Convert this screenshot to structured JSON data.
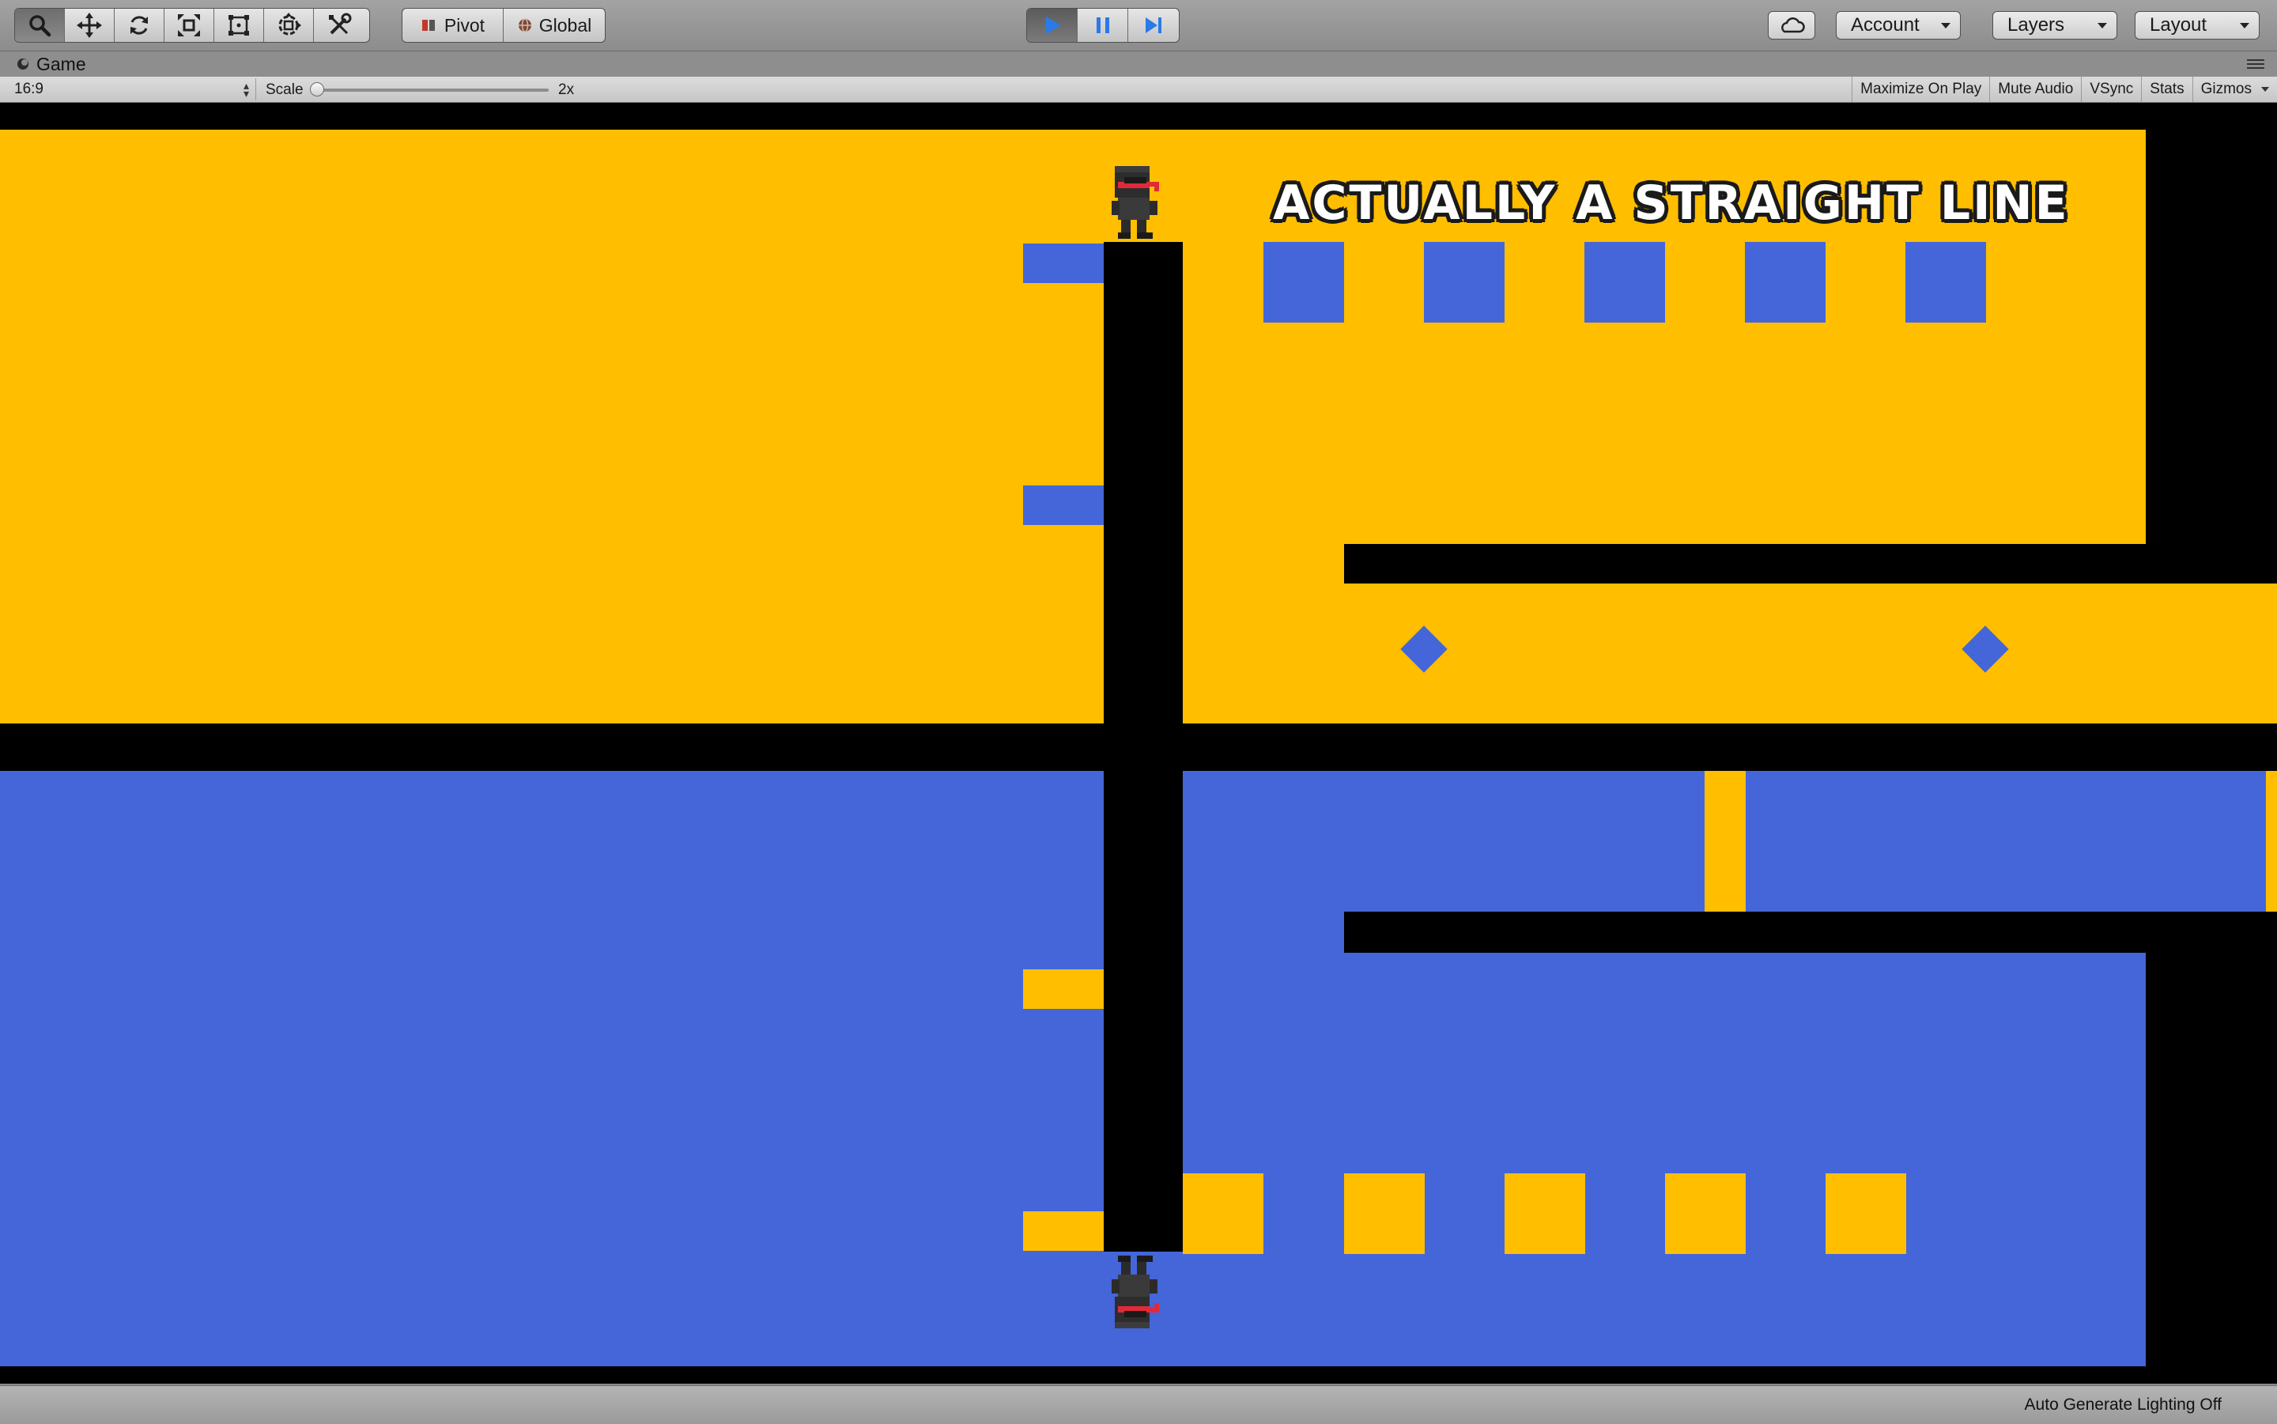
{
  "toolbar": {
    "tools": [
      "hand-tool",
      "move-tool",
      "rotate-tool",
      "scale-tool",
      "rect-tool",
      "transform-tool",
      "custom-tool"
    ],
    "active_tool": "hand-tool",
    "pivot_label": "Pivot",
    "global_label": "Global",
    "play_state": "playing",
    "account_label": "Account",
    "layers_label": "Layers",
    "layout_label": "Layout"
  },
  "game_tab": {
    "label": "Game"
  },
  "game_bar": {
    "aspect": "16:9",
    "scale_label": "Scale",
    "scale_value": "2x",
    "scale_fraction": 0,
    "toggles": [
      "Maximize On Play",
      "Mute Audio",
      "VSync",
      "Stats",
      "Gizmos"
    ]
  },
  "game": {
    "level_title": "ACTUALLY A STRAIGHT LINE",
    "top_world_color": "#ffbe00",
    "bottom_world_color": "#4466d9"
  },
  "status": {
    "lighting": "Auto Generate Lighting Off"
  },
  "colors": {
    "yellow": "#ffbe00",
    "blue": "#4466d9",
    "play_active": "#2a7ae8"
  }
}
